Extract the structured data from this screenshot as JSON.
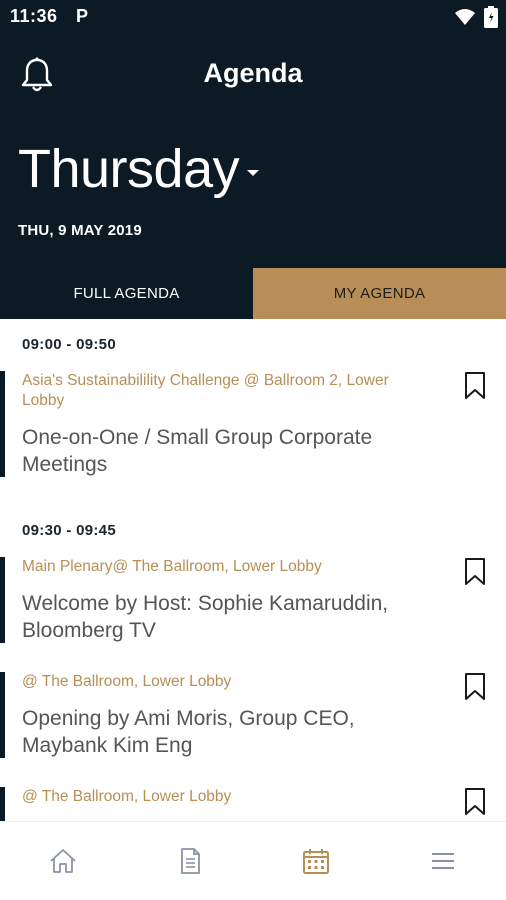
{
  "status_bar": {
    "time": "11:36",
    "indicator": "P"
  },
  "header": {
    "title": "Agenda",
    "notifications_icon": "bell-icon"
  },
  "day_selector": {
    "day": "Thursday",
    "date": "THU, 9 MAY 2019"
  },
  "tabs": [
    {
      "label": "FULL AGENDA",
      "active": false
    },
    {
      "label": "MY AGENDA",
      "active": true
    }
  ],
  "timeslots": [
    {
      "time": "09:00 - 09:50",
      "sessions": [
        {
          "location": "Asia's Sustainabilility Challenge @ Ballroom 2, Lower Lobby",
          "title": "One-on-One / Small Group Corporate Meetings"
        }
      ]
    },
    {
      "time": "09:30 - 09:45",
      "sessions": [
        {
          "location": "Main Plenary@ The Ballroom, Lower Lobby",
          "title": "Welcome by Host: Sophie Kamaruddin, Bloomberg TV"
        },
        {
          "location": "@ The Ballroom, Lower Lobby",
          "title": "Opening by Ami Moris, Group CEO, Maybank Kim Eng"
        },
        {
          "location": "@ The Ballroom, Lower Lobby",
          "title": ""
        }
      ]
    }
  ],
  "bottom_nav": [
    {
      "icon": "home-icon",
      "active": false
    },
    {
      "icon": "document-icon",
      "active": false
    },
    {
      "icon": "calendar-icon",
      "active": true
    },
    {
      "icon": "menu-icon",
      "active": false
    }
  ],
  "colors": {
    "header_bg": "#0b1a24",
    "accent": "#b78e55",
    "nav_icon": "#8a93a6"
  }
}
